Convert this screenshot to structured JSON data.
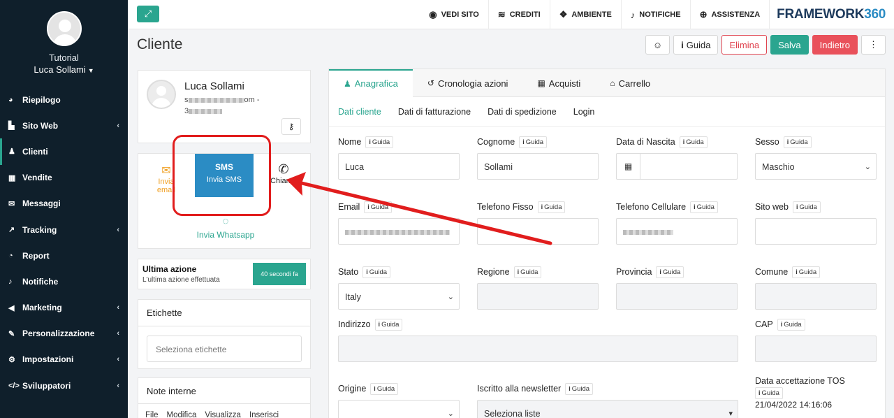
{
  "sidebar": {
    "role": "Tutorial",
    "user_name": "Luca Sollami",
    "items": [
      {
        "label": "Riepilogo",
        "icon": "dashboard-icon",
        "glyph": "◕",
        "has_chevron": false,
        "active": false
      },
      {
        "label": "Sito Web",
        "icon": "file-icon",
        "glyph": "▙",
        "has_chevron": true,
        "active": false
      },
      {
        "label": "Clienti",
        "icon": "person-icon",
        "glyph": "♟",
        "has_chevron": false,
        "active": true
      },
      {
        "label": "Vendite",
        "icon": "calculator-icon",
        "glyph": "▦",
        "has_chevron": false,
        "active": false
      },
      {
        "label": "Messaggi",
        "icon": "envelope-icon",
        "glyph": "✉",
        "has_chevron": false,
        "active": false
      },
      {
        "label": "Tracking",
        "icon": "line-chart-icon",
        "glyph": "↗",
        "has_chevron": true,
        "active": false
      },
      {
        "label": "Report",
        "icon": "pie-chart-icon",
        "glyph": "◔",
        "has_chevron": false,
        "active": false
      },
      {
        "label": "Notifiche",
        "icon": "bell-icon",
        "glyph": "♪",
        "has_chevron": false,
        "active": false
      },
      {
        "label": "Marketing",
        "icon": "megaphone-icon",
        "glyph": "◀",
        "has_chevron": true,
        "active": false
      },
      {
        "label": "Personalizzazione",
        "icon": "brush-icon",
        "glyph": "✎",
        "has_chevron": true,
        "active": false
      },
      {
        "label": "Impostazioni",
        "icon": "gear-icon",
        "glyph": "⚙",
        "has_chevron": true,
        "active": false
      },
      {
        "label": "Sviluppatori",
        "icon": "code-icon",
        "glyph": "</>",
        "has_chevron": true,
        "active": false
      }
    ]
  },
  "topbar": {
    "links": [
      {
        "label": "VEDI SITO",
        "icon": "eye-icon",
        "glyph": "◉"
      },
      {
        "label": "CREDITI",
        "icon": "coins-icon",
        "glyph": "≋"
      },
      {
        "label": "AMBIENTE",
        "icon": "cubes-icon",
        "glyph": "❖"
      },
      {
        "label": "NOTIFICHE",
        "icon": "bell-icon",
        "glyph": "♪"
      },
      {
        "label": "ASSISTENZA",
        "icon": "lifebuoy-icon",
        "glyph": "⊕"
      }
    ],
    "brand_text": "FRAMEWORK",
    "brand_accent": "360"
  },
  "header": {
    "title": "Cliente",
    "guide_label": "Guida",
    "delete_label": "Elimina",
    "save_label": "Salva",
    "back_label": "Indietro"
  },
  "profile": {
    "name": "Luca Sollami",
    "email_start": "s",
    "email_end": "om -",
    "phone_start": "3"
  },
  "actions": {
    "email_label": "Invia email",
    "sms_label": "Invia SMS",
    "sms_badge": "SMS",
    "call_label": "Chiama",
    "whatsapp_label": "Invia Whatsapp"
  },
  "last_action": {
    "title": "Ultima azione",
    "subtitle": "L'ultima azione effettuata",
    "badge": "40 secondi fa"
  },
  "tags": {
    "title": "Etichette",
    "placeholder": "Seleziona etichette"
  },
  "notes": {
    "title": "Note interne",
    "menu": [
      "File",
      "Modifica",
      "Visualizza",
      "Inserisci"
    ]
  },
  "tabs": [
    {
      "label": "Anagrafica",
      "icon": "user-edit-icon",
      "glyph": "♟",
      "active": true
    },
    {
      "label": "Cronologia azioni",
      "icon": "history-icon",
      "glyph": "↺",
      "active": false
    },
    {
      "label": "Acquisti",
      "icon": "calculator-icon",
      "glyph": "▦",
      "active": false
    },
    {
      "label": "Carrello",
      "icon": "basket-icon",
      "glyph": "⌂",
      "active": false
    }
  ],
  "subtabs": [
    {
      "label": "Dati cliente",
      "active": true
    },
    {
      "label": "Dati di fatturazione",
      "active": false
    },
    {
      "label": "Dati di spedizione",
      "active": false
    },
    {
      "label": "Login",
      "active": false
    }
  ],
  "guide_badge": "Guida",
  "form": {
    "nome": {
      "label": "Nome",
      "value": "Luca"
    },
    "cognome": {
      "label": "Cognome",
      "value": "Sollami"
    },
    "data_nascita": {
      "label": "Data di Nascita",
      "value": ""
    },
    "sesso": {
      "label": "Sesso",
      "value": "Maschio"
    },
    "email": {
      "label": "Email",
      "value": ""
    },
    "telefono_fisso": {
      "label": "Telefono Fisso",
      "value": ""
    },
    "telefono_cellulare": {
      "label": "Telefono Cellulare",
      "value": ""
    },
    "sito_web": {
      "label": "Sito web",
      "value": ""
    },
    "stato": {
      "label": "Stato",
      "value": "Italy"
    },
    "regione": {
      "label": "Regione",
      "value": ""
    },
    "provincia": {
      "label": "Provincia",
      "value": ""
    },
    "comune": {
      "label": "Comune",
      "value": ""
    },
    "indirizzo": {
      "label": "Indirizzo",
      "value": ""
    },
    "cap": {
      "label": "CAP",
      "value": ""
    },
    "origine": {
      "label": "Origine",
      "value": ""
    },
    "newsletter": {
      "label": "Iscritto alla newsletter",
      "value": "Seleziona liste"
    },
    "tos": {
      "label": "Data accettazione TOS",
      "value": "21/04/2022 14:16:06"
    }
  },
  "colors": {
    "accent": "#2aa58f",
    "sms_blue": "#2b8cc4",
    "danger": "#e0434f",
    "annotation_red": "#e11d1d",
    "sidebar_bg": "#0f1f2b"
  }
}
